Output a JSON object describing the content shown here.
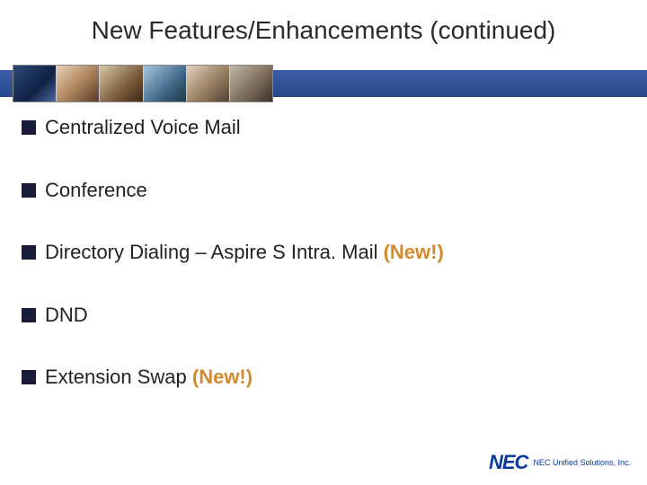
{
  "title": "New Features/Enhancements (continued)",
  "bullets": [
    {
      "text": "Centralized Voice Mail",
      "new": ""
    },
    {
      "text": "Conference",
      "new": ""
    },
    {
      "text": "Directory Dialing – Aspire S Intra. Mail ",
      "new": "(New!)"
    },
    {
      "text": "DND",
      "new": ""
    },
    {
      "text": "Extension Swap ",
      "new": "(New!)"
    }
  ],
  "logo": {
    "brand": "NEC",
    "sub": "NEC Unified Solutions, Inc."
  }
}
